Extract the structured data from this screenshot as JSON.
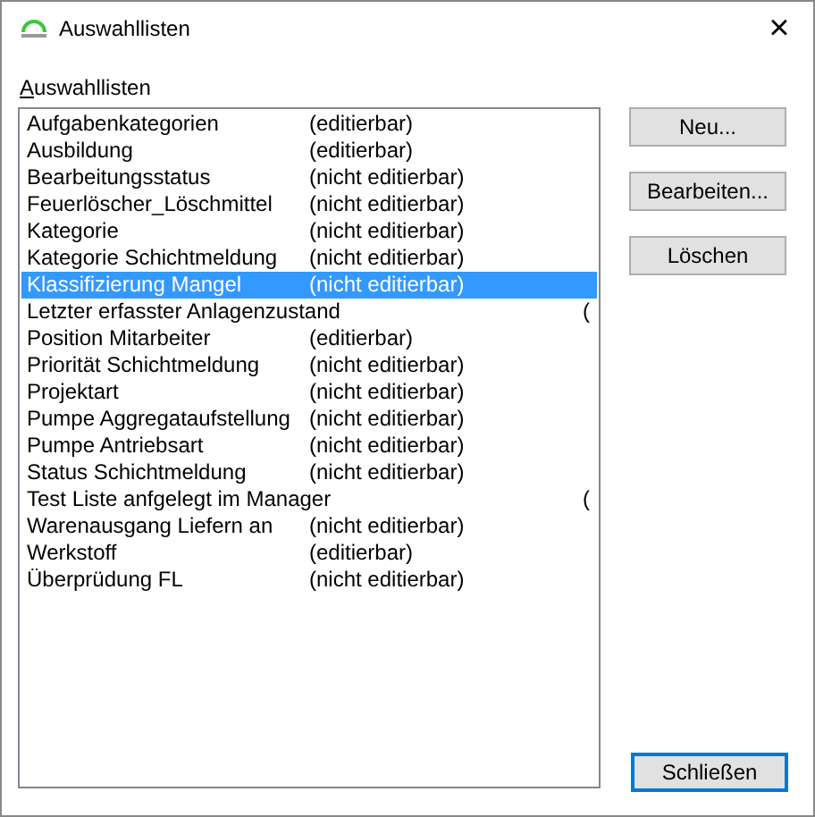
{
  "window": {
    "title": "Auswahllisten",
    "close": "×"
  },
  "list_label": "Auswahllisten",
  "list": [
    {
      "name": "Aufgabenkategorien",
      "status": "(editierbar)",
      "selected": false
    },
    {
      "name": "Ausbildung",
      "status": "(editierbar)",
      "selected": false
    },
    {
      "name": "Bearbeitungsstatus",
      "status": "(nicht editierbar)",
      "selected": false
    },
    {
      "name": "Feuerlöscher_Löschmittel",
      "status": "(nicht editierbar)",
      "selected": false
    },
    {
      "name": "Kategorie",
      "status": "(nicht editierbar)",
      "selected": false
    },
    {
      "name": "Kategorie Schichtmeldung",
      "status": "(nicht editierbar)",
      "selected": false
    },
    {
      "name": "Klassifizierung Mangel",
      "status": "(nicht editierbar)",
      "selected": true
    },
    {
      "name": "Letzter erfasster Anlagenzustand",
      "status": "(",
      "selected": false
    },
    {
      "name": "Position Mitarbeiter",
      "status": "(editierbar)",
      "selected": false
    },
    {
      "name": "Priorität Schichtmeldung",
      "status": "(nicht editierbar)",
      "selected": false
    },
    {
      "name": "Projektart",
      "status": "(nicht editierbar)",
      "selected": false
    },
    {
      "name": "Pumpe Aggregataufstellung",
      "status": "(nicht editierbar)",
      "selected": false
    },
    {
      "name": "Pumpe Antriebsart",
      "status": "(nicht editierbar)",
      "selected": false
    },
    {
      "name": "Status Schichtmeldung",
      "status": "(nicht editierbar)",
      "selected": false
    },
    {
      "name": "Test Liste anfgelegt im Manager",
      "status": "(",
      "selected": false
    },
    {
      "name": "Warenausgang Liefern an",
      "status": "(nicht editierbar)",
      "selected": false
    },
    {
      "name": "Werkstoff",
      "status": "(editierbar)",
      "selected": false
    },
    {
      "name": "Überprüdung FL",
      "status": "(nicht editierbar)",
      "selected": false
    }
  ],
  "buttons": [
    {
      "label": "Neu..."
    },
    {
      "label": "Bearbeiten..."
    },
    {
      "label": "Löschen"
    }
  ],
  "close_button": {
    "label": "Schließen",
    "default": true
  }
}
